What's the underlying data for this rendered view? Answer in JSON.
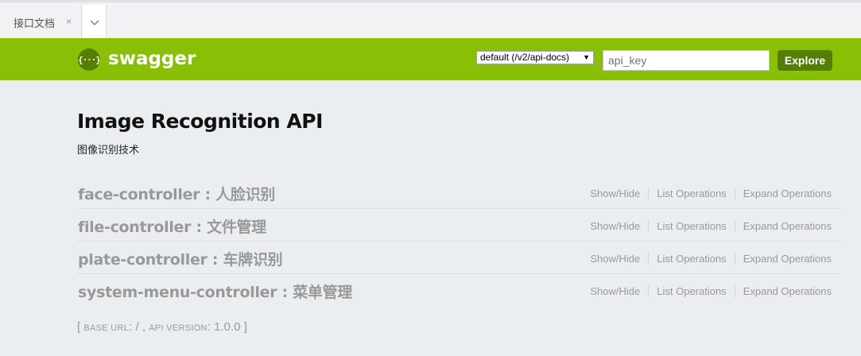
{
  "tabs": {
    "active_label": "接口文档",
    "close_glyph": "×",
    "dropdown_icon": "chevron-down-icon"
  },
  "header": {
    "logo_glyph": "{···}",
    "logo_text": "swagger",
    "spec_select_value": "default (/v2/api-docs)",
    "api_key_placeholder": "api_key",
    "explore_label": "Explore",
    "bg_color": "#89bf04",
    "button_color": "#547f00"
  },
  "api": {
    "title": "Image Recognition API",
    "description": "图像识别技术"
  },
  "resources": [
    {
      "name": "face-controller : 人脸识别"
    },
    {
      "name": "file-controller : 文件管理"
    },
    {
      "name": "plate-controller : 车牌识别"
    },
    {
      "name": "system-menu-controller : 菜单管理"
    }
  ],
  "operations": {
    "show_hide": "Show/Hide",
    "list": "List Operations",
    "expand": "Expand Operations"
  },
  "footer": {
    "open_bracket": "[",
    "base_url_label": "base url",
    "base_url_value": "/",
    "api_version_label": "api version",
    "api_version_value": "1.0.0",
    "close_bracket": "]"
  }
}
